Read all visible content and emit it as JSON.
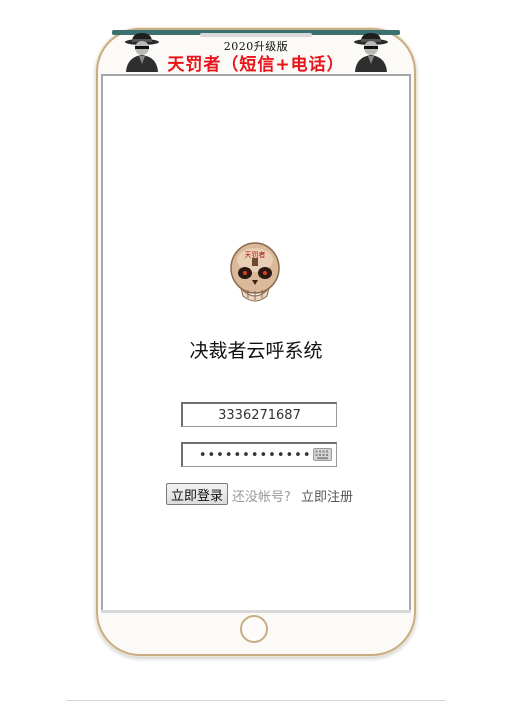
{
  "banner": {
    "badge": "2020升级版",
    "title": "天罚者（短信+电话）"
  },
  "app": {
    "title": "决裁者云呼系统"
  },
  "login": {
    "username_value": "3336271687",
    "password_value": "••••••••••••••",
    "login_label": "立即登录",
    "no_account_text": "还没帐号?",
    "register_label": "立即注册"
  },
  "icons": {
    "left_mascot": "hacker-fedora-icon",
    "right_mascot": "hacker-fedora-icon",
    "logo": "skull-icon",
    "keyboard": "keyboard-icon"
  },
  "colors": {
    "title_red": "#e8141a",
    "frame_gold": "#c9ad82"
  }
}
